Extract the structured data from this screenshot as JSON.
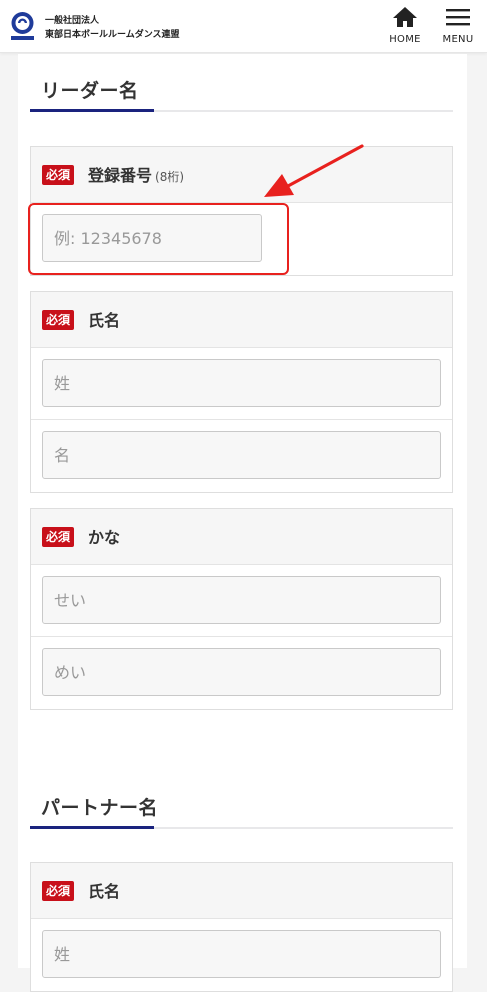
{
  "header": {
    "org_line1": "一般社団法人",
    "org_line2": "東部日本ボールルームダンス連盟",
    "home_label": "HOME",
    "menu_label": "MENU"
  },
  "leader": {
    "section_title": "リーダー名",
    "registration": {
      "required_badge": "必須",
      "label": "登録番号",
      "hint": "(8桁)",
      "placeholder": "例: 12345678"
    },
    "name": {
      "required_badge": "必須",
      "label": "氏名",
      "surname_placeholder": "姓",
      "given_placeholder": "名"
    },
    "kana": {
      "required_badge": "必須",
      "label": "かな",
      "surname_placeholder": "せい",
      "given_placeholder": "めい"
    }
  },
  "partner": {
    "section_title": "パートナー名",
    "name": {
      "required_badge": "必須",
      "label": "氏名",
      "surname_placeholder": "姓"
    }
  },
  "colors": {
    "accent_navy": "#1a237e",
    "required_red": "#c8101a",
    "annotation_red": "#e8211e"
  }
}
